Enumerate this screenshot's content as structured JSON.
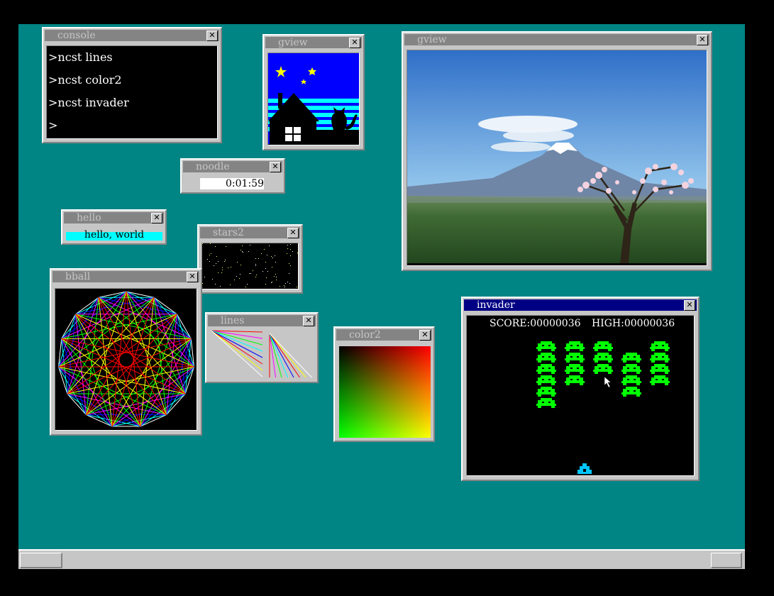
{
  "windows": {
    "console": {
      "title": "console",
      "lines": [
        ">ncst lines",
        ">ncst color2",
        ">ncst invader",
        ">"
      ]
    },
    "gview_small": {
      "title": "gview"
    },
    "gview_large": {
      "title": "gview"
    },
    "noodle": {
      "title": "noodle",
      "time": "0:01:59"
    },
    "hello": {
      "title": "hello",
      "message": "hello, world"
    },
    "stars2": {
      "title": "stars2"
    },
    "bball": {
      "title": "bball"
    },
    "lines": {
      "title": "lines"
    },
    "color2": {
      "title": "color2"
    },
    "invader": {
      "title": "invader",
      "score_label": "SCORE:00000036",
      "high_label": "HIGH:00000036",
      "score": 36,
      "high": 36
    }
  },
  "close_glyph": "✕",
  "colors": {
    "desktop": "#008484",
    "window_face": "#c6c6c6",
    "titlebar_inactive": "#848484",
    "titlebar_active": "#000084",
    "invader_green": "#00ff00",
    "player_cyan": "#00c6ff"
  }
}
